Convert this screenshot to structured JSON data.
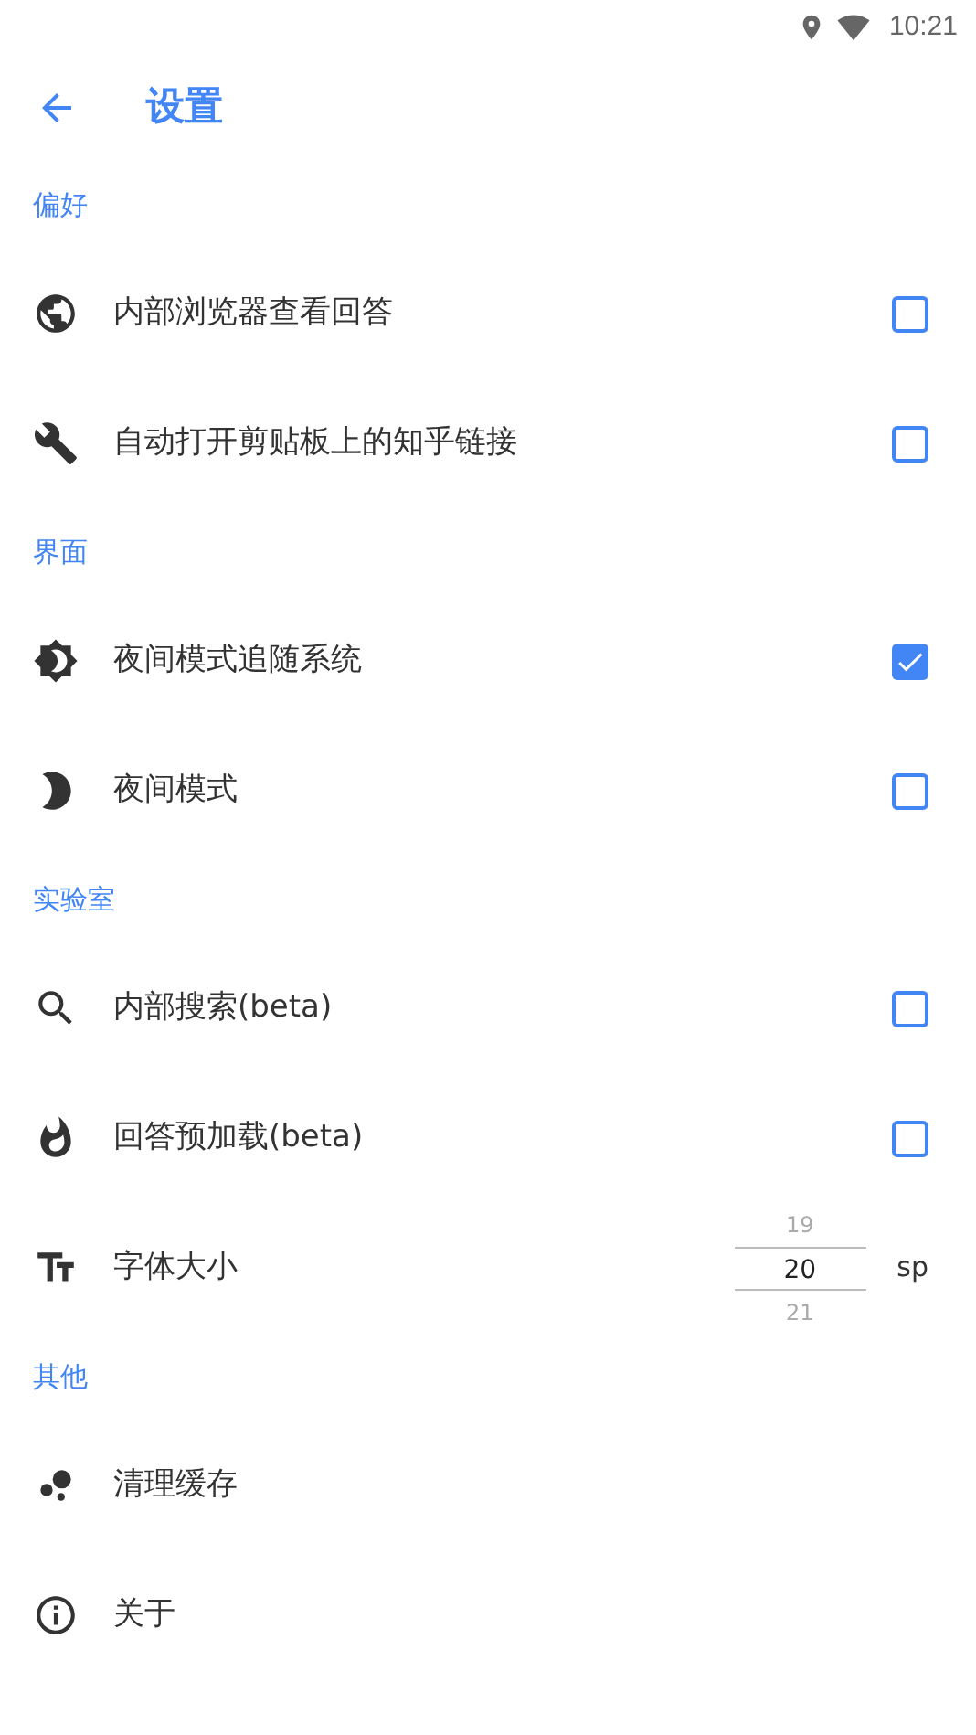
{
  "status_bar": {
    "time": "10:21"
  },
  "header": {
    "title": "设置"
  },
  "sections": [
    {
      "title": "偏好",
      "items": [
        {
          "kind": "checkbox",
          "label": "内部浏览器查看回答",
          "checked": false
        },
        {
          "kind": "checkbox",
          "label": "自动打开剪贴板上的知乎链接",
          "checked": false
        }
      ]
    },
    {
      "title": "界面",
      "items": [
        {
          "kind": "checkbox",
          "label": "夜间模式追随系统",
          "checked": true
        },
        {
          "kind": "checkbox",
          "label": "夜间模式",
          "checked": false
        }
      ]
    },
    {
      "title": "实验室",
      "items": [
        {
          "kind": "checkbox",
          "label": "内部搜索(beta)",
          "checked": false
        },
        {
          "kind": "checkbox",
          "label": "回答预加载(beta)",
          "checked": false
        },
        {
          "kind": "picker",
          "label": "字体大小",
          "options": [
            {
              "label": "19",
              "selected": false
            },
            {
              "label": "20",
              "selected": true
            },
            {
              "label": "21",
              "selected": false
            }
          ],
          "unit": "sp"
        }
      ]
    },
    {
      "title": "其他",
      "items": [
        {
          "kind": "action",
          "label": "清理缓存"
        },
        {
          "kind": "action",
          "label": "关于"
        }
      ]
    }
  ]
}
